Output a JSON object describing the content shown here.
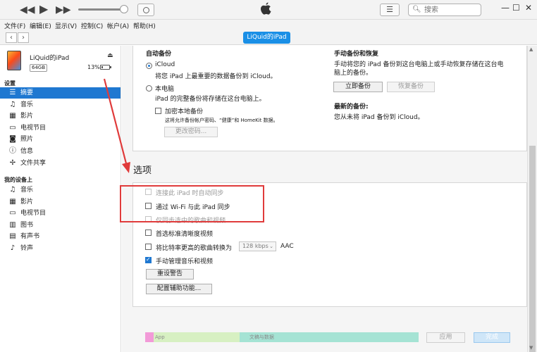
{
  "toolbar": {
    "prev": "◀◀",
    "play": "▶",
    "next": "▶▶",
    "list_glyph": "☰",
    "search_placeholder": "搜索",
    "window_min": "—",
    "window_max": "☐",
    "window_close": "✕"
  },
  "menu": [
    "文件(F)",
    "编辑(E)",
    "显示(V)",
    "控制(C)",
    "帐户(A)",
    "帮助(H)"
  ],
  "nav": {
    "back": "‹",
    "forward": "›",
    "device_tab": "LiQuid的iPad"
  },
  "device": {
    "name": "LiQuid的iPad",
    "capacity": "64GB",
    "battery": "13%",
    "eject": "⏏"
  },
  "sidebar": {
    "settings_title": "设置",
    "settings_items": [
      {
        "label": "摘要",
        "icon": "list-icon",
        "glyph": "☰"
      },
      {
        "label": "音乐",
        "icon": "music-note-icon",
        "glyph": "♫"
      },
      {
        "label": "影片",
        "icon": "film-icon",
        "glyph": "▦"
      },
      {
        "label": "电视节目",
        "icon": "tv-icon",
        "glyph": "▭"
      },
      {
        "label": "照片",
        "icon": "camera-icon",
        "glyph": "◙"
      },
      {
        "label": "信息",
        "icon": "info-icon",
        "glyph": "ⓘ"
      },
      {
        "label": "文件共享",
        "icon": "apps-icon",
        "glyph": "✢"
      }
    ],
    "ondevice_title": "我的设备上",
    "ondevice_items": [
      {
        "label": "音乐",
        "icon": "music-note-icon",
        "glyph": "♫"
      },
      {
        "label": "影片",
        "icon": "film-icon",
        "glyph": "▦"
      },
      {
        "label": "电视节目",
        "icon": "tv-icon",
        "glyph": "▭"
      },
      {
        "label": "图书",
        "icon": "book-icon",
        "glyph": "▥"
      },
      {
        "label": "有声书",
        "icon": "audiobook-icon",
        "glyph": "▤"
      },
      {
        "label": "铃声",
        "icon": "bell-icon",
        "glyph": "♪"
      }
    ]
  },
  "backup": {
    "auto_title": "自动备份",
    "icloud_label": "iCloud",
    "icloud_desc": "将您 iPad 上最重要的数据备份到 iCloud。",
    "local_label": "本电脑",
    "local_desc": "iPad 的完整备份将存储在这台电脑上。",
    "encrypt_label": "加密本地备份",
    "encrypt_desc": "这将允许备份帐户密码、“健康”和 HomeKit 数据。",
    "change_password": "更改密码...",
    "manual_title": "手动备份和恢复",
    "manual_desc_1": "手动将您的 iPad 备份到这台电脑上或手动恢复存储在这台电",
    "manual_desc_2": "脑上的备份。",
    "backup_now": "立即备份",
    "restore_backup": "恢复备份",
    "latest_title": "最新的备份:",
    "latest_desc": "您从未将 iPad 备份到 iCloud。"
  },
  "options": {
    "title": "选项",
    "opt_auto_sync": "连接此 iPad 时自动同步",
    "opt_wifi_sync": "通过 Wi-Fi 与此 iPad 同步",
    "opt_selected_only": "仅同步选中的歌曲和视频",
    "opt_sd_video": "首选标准清晰度视频",
    "opt_convert_prefix": "将比特率更高的歌曲转换为",
    "opt_convert_bitrate": "128 kbps",
    "opt_convert_suffix": "AAC",
    "opt_manual_manage": "手动管理音乐和视频",
    "reset_warnings": "重设警告",
    "configure_accessibility": "配置辅助功能..."
  },
  "capacity_bar": {
    "segments": [
      {
        "label": "App",
        "color": "#d7f0c2",
        "start": 0.0,
        "share": 0.345
      },
      {
        "label": "文稿与数据",
        "color": "#a5e3d4",
        "start": 0.345,
        "share": 0.655
      }
    ],
    "marker_color": "#f29ad8"
  },
  "bottom": {
    "apply": "应用",
    "done": "完成"
  },
  "colors": {
    "accent": "#1f78d1",
    "device_pill": "#1a8fe6",
    "annotation": "#e03b3b"
  }
}
